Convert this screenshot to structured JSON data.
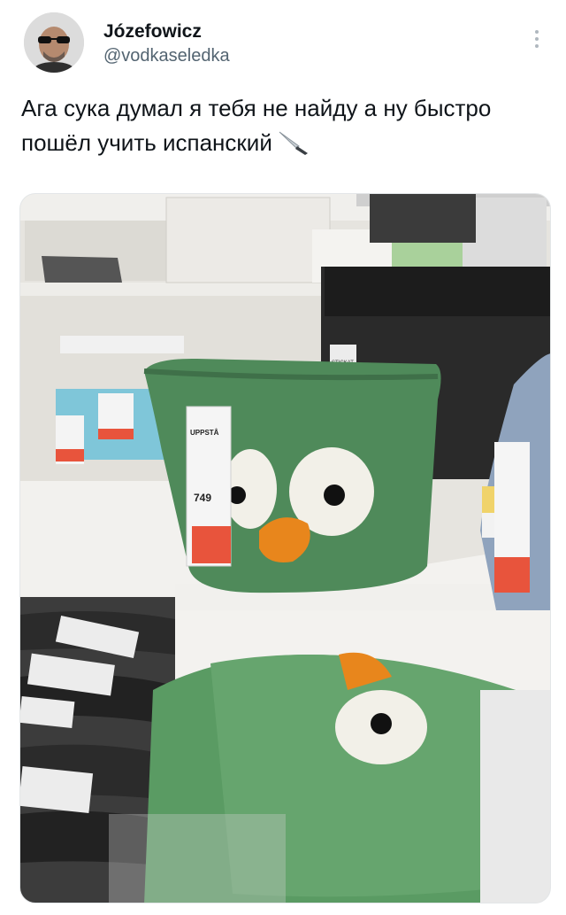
{
  "author": {
    "display_name": "Józefowicz",
    "handle": "@vodkaseledka"
  },
  "tweet": {
    "text": "Ага сука думал я тебя не найду а ну быстро пошёл учить испанский",
    "emoji": "knife-icon"
  },
  "photo": {
    "price_tag": {
      "product": "UPPSTÅ",
      "price": "749"
    },
    "shelf_tag": "STICKAT",
    "colors": {
      "basket_green": "#4f8a5a",
      "eye_white": "#f2f0e8",
      "beak_orange": "#e8861c",
      "price_red": "#e8543c"
    }
  }
}
